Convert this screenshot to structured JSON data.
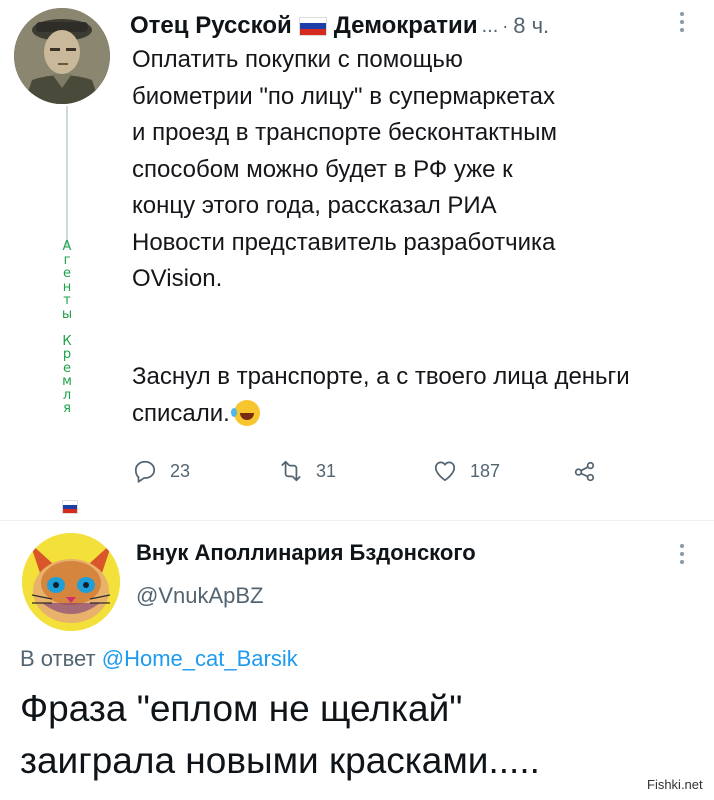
{
  "tweet1": {
    "author_name": "Отец Русской",
    "author_name_rest": "Демократии",
    "ellipsis": "...",
    "dot": "·",
    "time": "8 ч.",
    "more_label": "⋮",
    "text_main": "Оплатить покупки с помощью\nбиометрии \"по лицу\" в супермаркетах\nи проезд в транспорте бесконтактным\nспособом можно будет в РФ уже к\nконцу этого года, рассказал РИА\nНовости представитель разработчика\nOVision.",
    "text_joke": "Заснул в транспорте, а с твоего лица деньги списали.",
    "emoji": "rolling-on-floor-laughing-emoji",
    "vertical_letters": [
      "А",
      "г",
      "е",
      "н",
      "т",
      "ы",
      "",
      "К",
      "р",
      "е",
      "м",
      "л",
      "я"
    ],
    "actions": {
      "reply_count": "23",
      "retweet_count": "31",
      "like_count": "187"
    },
    "flag_colors": [
      "#ffffff",
      "#1c3fa8",
      "#d52b1e"
    ],
    "vertical_text_color": "#1ea34a"
  },
  "tweet2": {
    "author_name": "Внук Аполлинария Бздонского",
    "handle": "@VnukApBZ",
    "more_label": "⋮",
    "reply_prefix": "В ответ",
    "reply_mention": "@Home_cat_Barsik",
    "text_line1": "Фраза \"еплом не щелкай\"",
    "text_line2": "заиграла новыми красками....."
  },
  "watermark": "Fishki.net",
  "colors": {
    "link": "#1d9bf0",
    "muted": "#536471",
    "text": "#0f1419"
  }
}
